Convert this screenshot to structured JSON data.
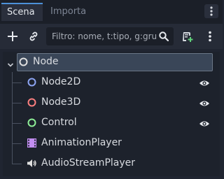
{
  "tabs": [
    {
      "label": "Scena"
    },
    {
      "label": "Importa"
    }
  ],
  "toolbar": {
    "add_icon": "plus-icon",
    "link_icon": "link-icon",
    "search_placeholder": "Filtro: nome, t:tipo, g:gruppo",
    "scene_icon": "add-script-icon",
    "menu_icon": "vertical-dots-icon"
  },
  "tree": {
    "root": {
      "label": "Node",
      "icon": "node-ring-icon",
      "icon_color": "#e0e0e0",
      "expanded": true
    },
    "children": [
      {
        "label": "Node2D",
        "icon": "node2d-ring-icon",
        "icon_color": "#8da5f3",
        "visible": true
      },
      {
        "label": "Node3D",
        "icon": "node3d-ring-icon",
        "icon_color": "#fc7f7f",
        "visible": true
      },
      {
        "label": "Control",
        "icon": "control-ring-icon",
        "icon_color": "#8eef97",
        "visible": true
      },
      {
        "label": "AnimationPlayer",
        "icon": "film-strip-icon",
        "icon_color": "#c38ef1",
        "visible": null
      },
      {
        "label": "AudioStreamPlayer",
        "icon": "speaker-icon",
        "icon_color": "#e0e0e0",
        "visible": null
      }
    ]
  },
  "colors": {
    "accent": "#4c91d9",
    "background": "#202531",
    "selected_row": "#3a4658"
  }
}
